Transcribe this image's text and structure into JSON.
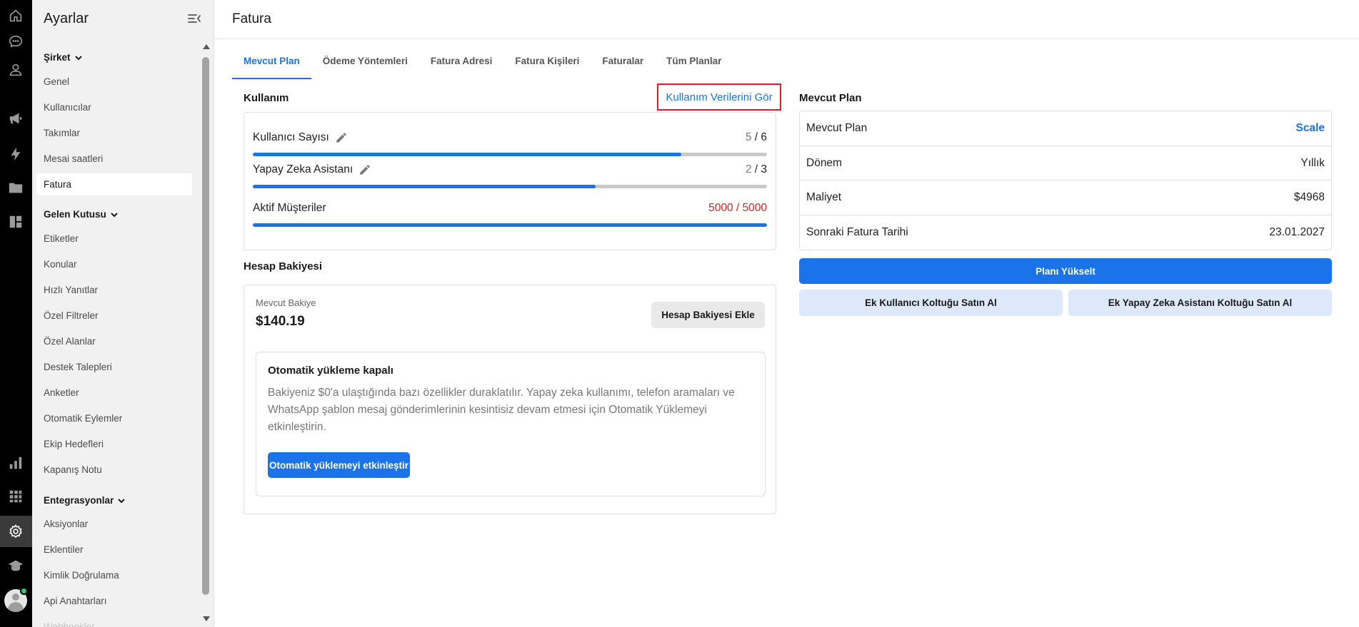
{
  "rail": {
    "icons": [
      "home-icon",
      "chat-icon",
      "contacts-icon",
      "megaphone-icon",
      "lightning-icon",
      "inbox-folder-icon",
      "dashboard-icon",
      "reports-icon",
      "apps-grid-icon",
      "settings-icon",
      "academy-icon"
    ],
    "active": "settings-icon",
    "status_color": "#2ecc71"
  },
  "sidebar": {
    "title": "Ayarlar",
    "sections": [
      {
        "label": "Şirket",
        "items": [
          "Genel",
          "Kullanıcılar",
          "Takımlar",
          "Mesai saatleri",
          "Fatura"
        ]
      },
      {
        "label": "Gelen Kutusu",
        "items": [
          "Etiketler",
          "Konular",
          "Hızlı Yanıtlar",
          "Özel Filtreler",
          "Özel Alanlar",
          "Destek Talepleri",
          "Anketler",
          "Otomatik Eylemler",
          "Ekip Hedefleri",
          "Kapanış Notu"
        ]
      },
      {
        "label": "Entegrasyonlar",
        "items": [
          "Aksiyonlar",
          "Eklentiler",
          "Kimlik Doğrulama",
          "Api Anahtarları",
          "Webhookler"
        ]
      }
    ],
    "active_item": "Fatura"
  },
  "page": {
    "title": "Fatura"
  },
  "tabs": [
    "Mevcut Plan",
    "Ödeme Yöntemleri",
    "Fatura Adresi",
    "Fatura Kişileri",
    "Faturalar",
    "Tüm Planlar"
  ],
  "active_tab": "Mevcut Plan",
  "usage": {
    "title": "Kullanım",
    "link": "Kullanım Verilerini Gör",
    "rows": [
      {
        "label": "Kullanıcı Sayısı",
        "used": "5",
        "total": "6",
        "progress": 0.833
      },
      {
        "label": "Yapay Zeka Asistanı",
        "used": "2",
        "total": "3",
        "progress": 0.667
      },
      {
        "label": "Aktif Müşteriler",
        "count_text": "5000 / 5000",
        "progress": 1.0
      }
    ]
  },
  "balance": {
    "title": "Hesap Bakiyesi",
    "label": "Mevcut Bakiye",
    "amount": "$140.19",
    "add_button": "Hesap Bakiyesi Ekle",
    "auto_title": "Otomatik yükleme kapalı",
    "auto_description": "Bakiyeniz $0'a ulaştığında bazı özellikler duraklatılır. Yapay zeka kullanımı, telefon aramaları ve WhatsApp şablon mesaj gönderimlerinin kesintisiz devam etmesi için Otomatik Yüklemeyi etkinleştirin.",
    "auto_button": "Otomatik yüklemeyi etkinleştir"
  },
  "plan": {
    "title": "Mevcut Plan",
    "rows": [
      {
        "key": "Mevcut Plan",
        "value": "Scale"
      },
      {
        "key": "Dönem",
        "value": "Yıllık"
      },
      {
        "key": "Maliyet",
        "value": "$4968"
      },
      {
        "key": "Sonraki Fatura Tarihi",
        "value": "23.01.2027"
      }
    ],
    "upgrade_button": "Planı Yükselt",
    "buy_seat_button": "Ek Kullanıcı Koltuğu Satın Al",
    "buy_ai_seat_button": "Ek Yapay Zeka Asistanı Koltuğu Satın Al"
  },
  "colors": {
    "accent": "#1a73e8",
    "danger": "#e02020",
    "rail_bg": "#000000",
    "sidebar_bg": "#f1f1f1"
  }
}
